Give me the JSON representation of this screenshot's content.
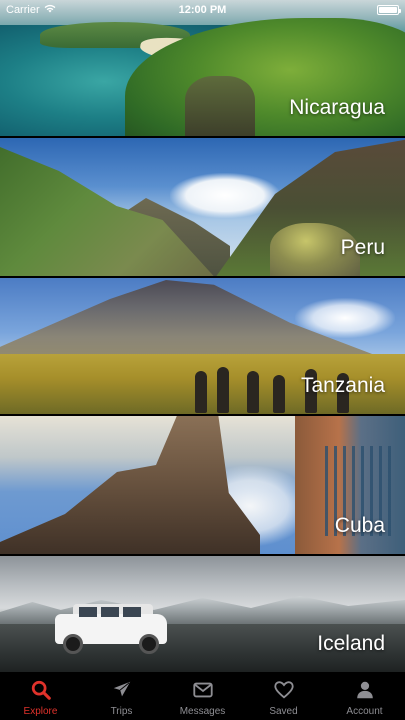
{
  "status_bar": {
    "carrier": "Carrier",
    "time": "12:00 PM"
  },
  "destinations": [
    {
      "name": "Nicaragua"
    },
    {
      "name": "Peru"
    },
    {
      "name": "Tanzania"
    },
    {
      "name": "Cuba"
    },
    {
      "name": "Iceland"
    }
  ],
  "tab_bar": {
    "active_tab": "Explore",
    "active_color": "#e0322b",
    "inactive_color": "#8e8e93",
    "tabs": [
      {
        "label": "Explore",
        "icon": "search-icon"
      },
      {
        "label": "Trips",
        "icon": "airplane-icon"
      },
      {
        "label": "Messages",
        "icon": "envelope-icon"
      },
      {
        "label": "Saved",
        "icon": "heart-icon"
      },
      {
        "label": "Account",
        "icon": "person-icon"
      }
    ]
  }
}
